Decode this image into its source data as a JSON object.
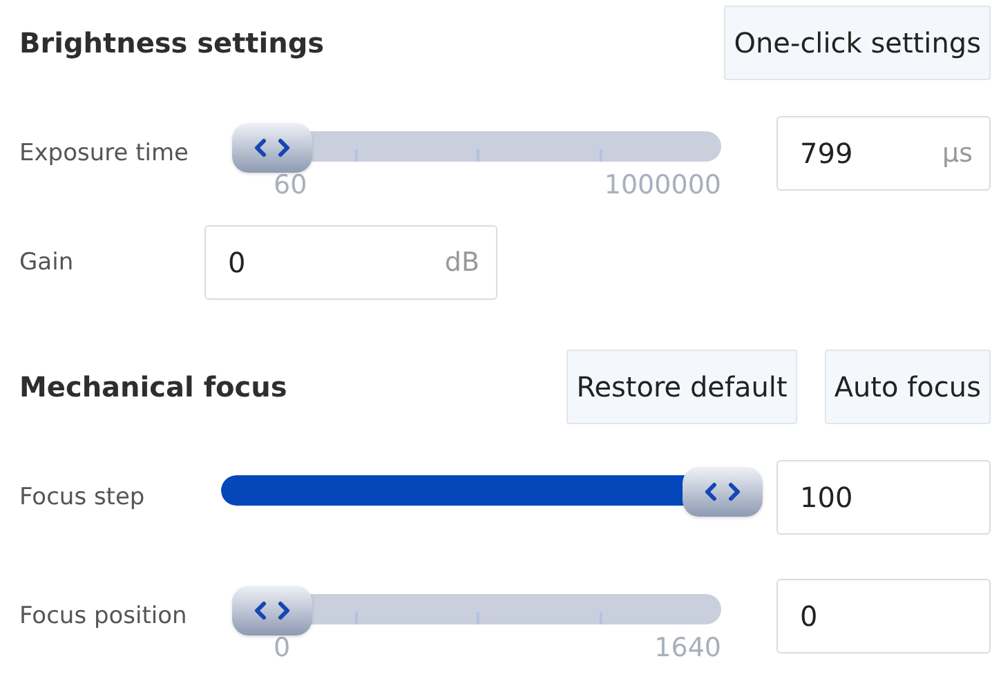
{
  "sections": [
    {
      "title": "Brightness settings",
      "buttons": [
        "One-click settings"
      ],
      "rows": [
        {
          "kind": "slider",
          "label": "Exposure time",
          "level": 0,
          "min_label": "60",
          "max_label": "1000000",
          "field": {
            "value": "799",
            "unit": "μs"
          }
        },
        {
          "kind": "field",
          "label": "Gain",
          "field": {
            "value": "0",
            "unit": "dB"
          }
        }
      ]
    },
    {
      "title": "Mechanical focus",
      "buttons": [
        "Restore default",
        "Auto focus"
      ],
      "rows": [
        {
          "kind": "slider",
          "label": "Focus step",
          "level": 1,
          "field": {
            "value": "100"
          }
        },
        {
          "kind": "slider",
          "label": "Focus position",
          "level": 0,
          "min_label": "0",
          "max_label": "1640",
          "field": {
            "value": "0"
          }
        }
      ]
    }
  ]
}
